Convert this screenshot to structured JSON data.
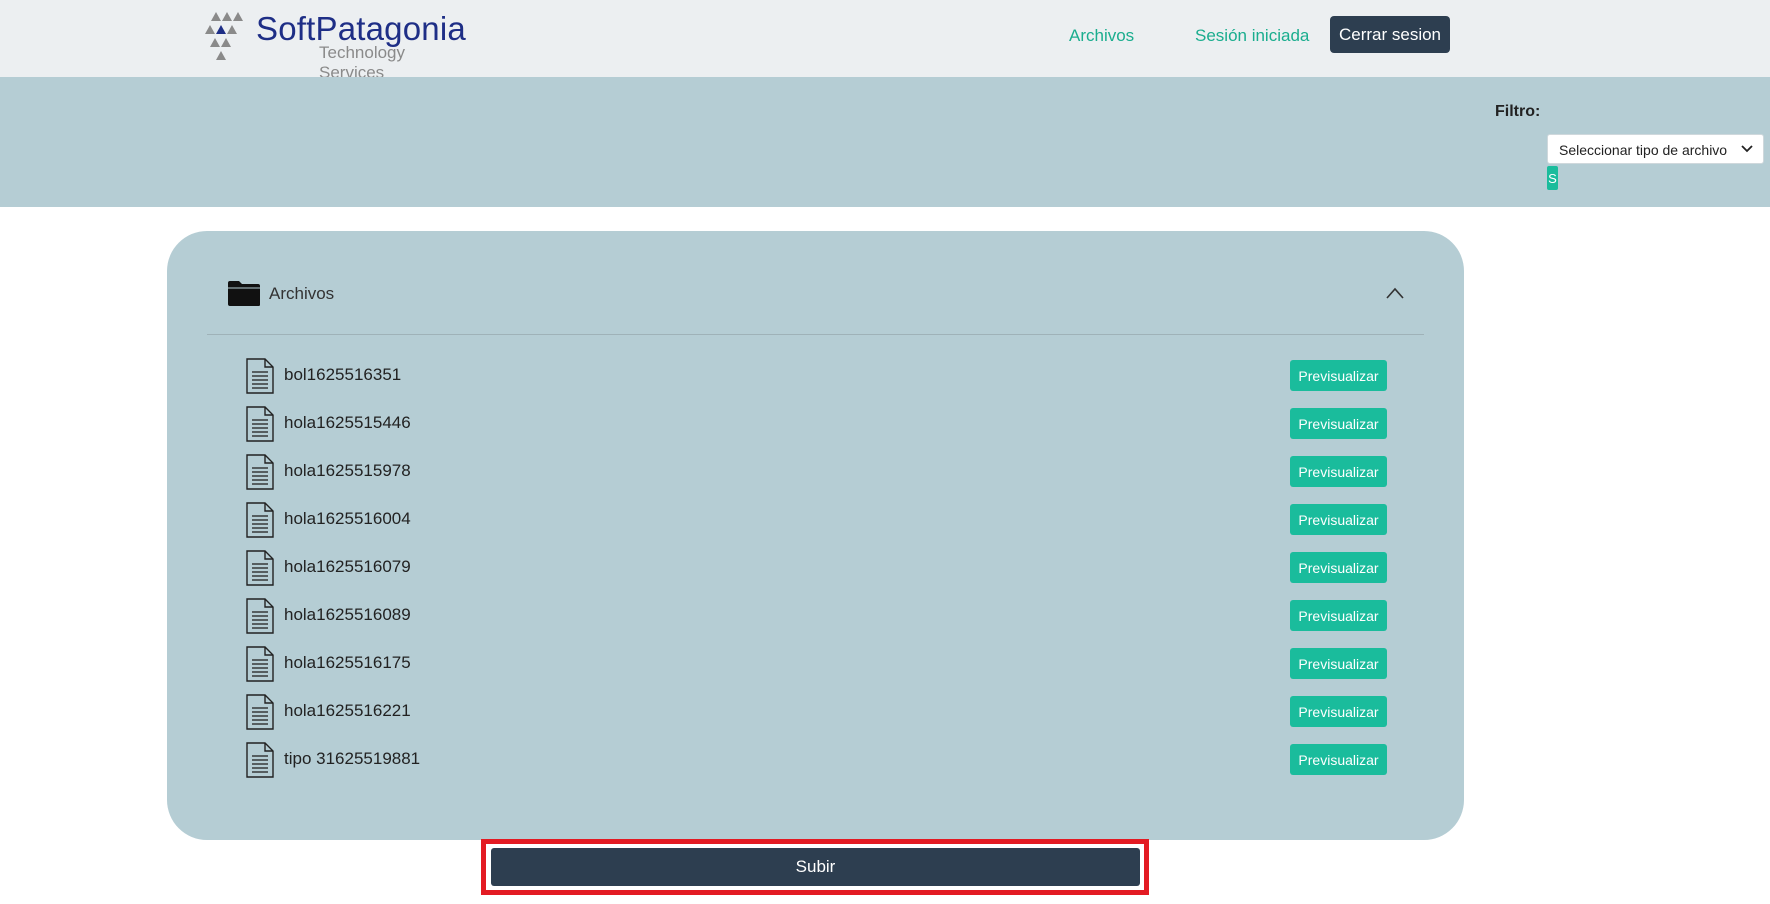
{
  "brand": {
    "name": "SoftPatagonia",
    "tagline": "Technology Services",
    "colors": {
      "primary": "#1e2e86",
      "dark_triangle": "#1e2e86",
      "grey_triangle": "#8a8a8a"
    }
  },
  "nav": {
    "files_link": "Archivos",
    "session_link": "Sesión iniciada",
    "logout_button": "Cerrar sesion"
  },
  "filter": {
    "label": "Filtro:",
    "select_value": "Seleccionar tipo de archivo",
    "submit_label": "S"
  },
  "files_panel": {
    "title": "Archivos",
    "folder_icon": "folder-icon",
    "collapse_icon": "chevron-up-icon",
    "preview_label": "Previsualizar",
    "items": [
      {
        "name": "bol1625516351"
      },
      {
        "name": "hola1625515446"
      },
      {
        "name": "hola1625515978"
      },
      {
        "name": "hola1625516004"
      },
      {
        "name": "hola1625516079"
      },
      {
        "name": "hola1625516089"
      },
      {
        "name": "hola1625516175"
      },
      {
        "name": "hola1625516221"
      },
      {
        "name": "tipo 31625519881"
      }
    ]
  },
  "upload_button": "Subir",
  "colors": {
    "accent": "#1abc9c",
    "dark": "#2d3e50",
    "panel": "#b5cdd4",
    "header": "#eceff1",
    "highlight": "#e31b23"
  }
}
